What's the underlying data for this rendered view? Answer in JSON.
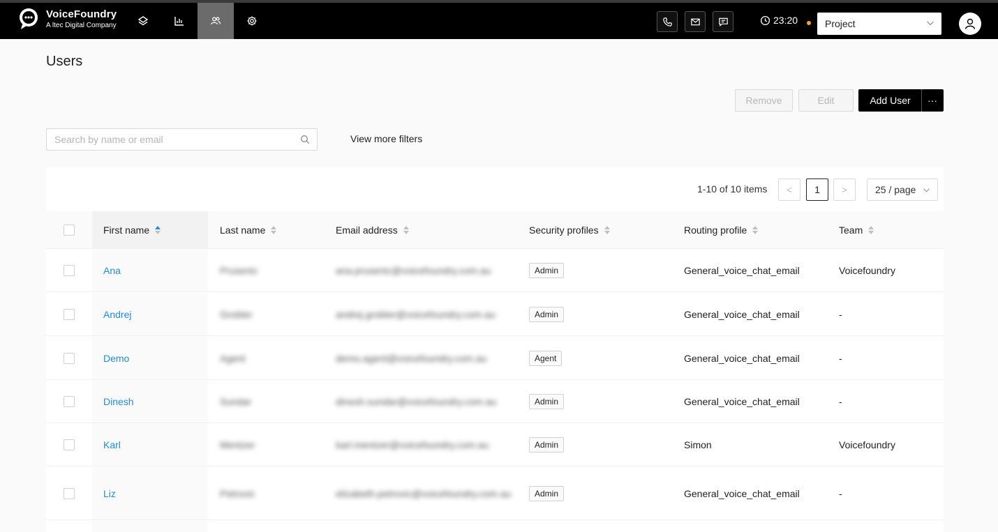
{
  "brand": {
    "name": "VoiceFoundry",
    "tagline": "A ltec Digital Company"
  },
  "nav": [
    {
      "name": "layers-icon"
    },
    {
      "name": "chart-icon"
    },
    {
      "name": "users-icon",
      "active": true
    },
    {
      "name": "gear-icon"
    }
  ],
  "header": {
    "time": "23:20",
    "status_color": "#f5a623",
    "project_label": "Project"
  },
  "page": {
    "title": "Users"
  },
  "actions": {
    "remove": "Remove",
    "edit": "Edit",
    "add_user": "Add User",
    "more": "···"
  },
  "search": {
    "placeholder": "Search by name or email",
    "value": ""
  },
  "filters": {
    "label": "View more filters"
  },
  "pagination": {
    "summary": "1-10 of 10 items",
    "prev": "<",
    "current": "1",
    "next": ">",
    "page_size": "25 / page"
  },
  "columns": [
    "First name",
    "Last name",
    "Email address",
    "Security profiles",
    "Routing profile",
    "Team"
  ],
  "rows": [
    {
      "first": "Ana",
      "last": "Prusenic",
      "email": "ana.prusenic@voicefoundry.com.au",
      "security": "Admin",
      "routing": "General_voice_chat_email",
      "team": "Voicefoundry"
    },
    {
      "first": "Andrej",
      "last": "Grobler",
      "email": "andrej.grobler@voicefoundry.com.au",
      "security": "Admin",
      "routing": "General_voice_chat_email",
      "team": "-"
    },
    {
      "first": "Demo",
      "last": "Agent",
      "email": "demo.agent@voicefoundry.com.au",
      "security": "Agent",
      "routing": "General_voice_chat_email",
      "team": "-"
    },
    {
      "first": "Dinesh",
      "last": "Sundar",
      "email": "dinesh.sundar@voicefoundry.com.au",
      "security": "Admin",
      "routing": "General_voice_chat_email",
      "team": "-"
    },
    {
      "first": "Karl",
      "last": "Mentzer",
      "email": "karl.mentzer@voicefoundry.com.au",
      "security": "Admin",
      "routing": "Simon",
      "team": "Voicefoundry"
    },
    {
      "first": "Liz",
      "last": "Petrovic",
      "email": "elizabeth.petrovic@voicefoundry.com.au",
      "security": "Admin",
      "routing": "General_voice_chat_email",
      "team": "-"
    }
  ],
  "colors": {
    "accent": "#1a8fdd",
    "topbar": "#000000",
    "active_nav": "#6b6b6b"
  }
}
